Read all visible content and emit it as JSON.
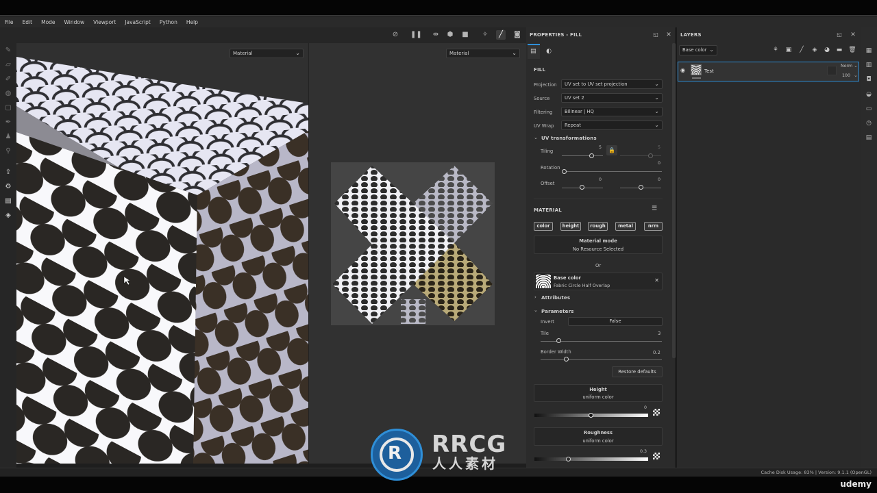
{
  "menu": [
    "File",
    "Edit",
    "Mode",
    "Window",
    "Viewport",
    "JavaScript",
    "Python",
    "Help"
  ],
  "viewport": {
    "left_mode": "Material",
    "right_mode": "Material"
  },
  "properties": {
    "title": "PROPERTIES - FILL",
    "fill_header": "FILL",
    "projection_label": "Projection",
    "projection_value": "UV set to UV set projection",
    "source_label": "Source",
    "source_value": "UV set 2",
    "filtering_label": "Filtering",
    "filtering_value": "Bilinear | HQ",
    "uvwrap_label": "UV Wrap",
    "uvwrap_value": "Repeat",
    "uv_transform_header": "UV transformations",
    "tiling_label": "Tiling",
    "tiling_value_a": "5",
    "tiling_value_b": "5",
    "rotation_label": "Rotation",
    "rotation_value": "0",
    "offset_label": "Offset",
    "offset_value_a": "0",
    "offset_value_b": "0",
    "material_header": "MATERIAL",
    "channels": [
      "color",
      "height",
      "rough",
      "metal",
      "nrm"
    ],
    "material_mode_title": "Material mode",
    "material_mode_sub": "No Resource Selected",
    "or_text": "Or",
    "base_color_title": "Base color",
    "base_color_sub": "Fabric Circle Half Overlap",
    "attributes_label": "Attributes",
    "parameters_label": "Parameters",
    "invert_label": "Invert",
    "invert_value": "False",
    "tile_label": "Tile",
    "tile_value": "3",
    "border_width_label": "Border Width",
    "border_width_value": "0.2",
    "restore_label": "Restore defaults",
    "height_title": "Height",
    "height_sub": "uniform color",
    "height_value": "0",
    "roughness_title": "Roughness",
    "roughness_sub": "uniform color",
    "roughness_value": "0.3"
  },
  "layers": {
    "title": "LAYERS",
    "channel_select": "Base color",
    "layer_name": "Test",
    "blend_mode": "Norm",
    "opacity": "100"
  },
  "status": {
    "text": "Cache Disk Usage:   83% | Version: 9.1.1 (OpenGL)"
  },
  "watermark": {
    "brand": "RRCG",
    "sub": "人人素材",
    "udemy": "udemy"
  },
  "colors": {
    "accent": "#2f8fd8",
    "panel": "#2b2b2b",
    "viewport": "#303030"
  }
}
